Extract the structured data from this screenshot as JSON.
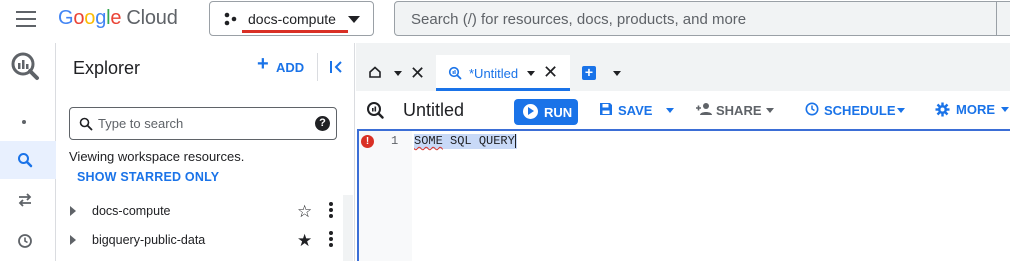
{
  "header": {
    "logo_google": [
      "G",
      "o",
      "o",
      "g",
      "l",
      "e"
    ],
    "logo_cloud": "Cloud",
    "project_name": "docs-compute",
    "search_placeholder": "Search (/) for resources, docs, products, and more"
  },
  "rail": {
    "items": [
      {
        "icon": "bigquery-logo-icon"
      },
      {
        "icon": "dot-icon"
      },
      {
        "icon": "search-icon",
        "active": true
      },
      {
        "icon": "transfers-icon"
      },
      {
        "icon": "history-icon"
      }
    ]
  },
  "explorer": {
    "title": "Explorer",
    "add_label": "ADD",
    "search_placeholder": "Type to search",
    "viewing_text": "Viewing workspace resources.",
    "show_starred_label": "SHOW STARRED ONLY",
    "tree": [
      {
        "label": "docs-compute",
        "starred": false
      },
      {
        "label": "bigquery-public-data",
        "starred": true
      }
    ]
  },
  "tabs": {
    "active_tab_label": "*Untitled"
  },
  "toolbar": {
    "query_title": "Untitled",
    "run_label": "RUN",
    "save_label": "SAVE",
    "share_label": "SHARE",
    "schedule_label": "SCHEDULE",
    "more_label": "MORE"
  },
  "editor": {
    "lines": [
      {
        "number": "1",
        "code_error_word": "SOME",
        "code_rest": " SQL QUERY",
        "has_error": true
      }
    ]
  },
  "colors": {
    "accent": "#1a73e8",
    "error": "#d93025",
    "selection": "#c8d9f7",
    "underline_highlight": "#d93025"
  }
}
